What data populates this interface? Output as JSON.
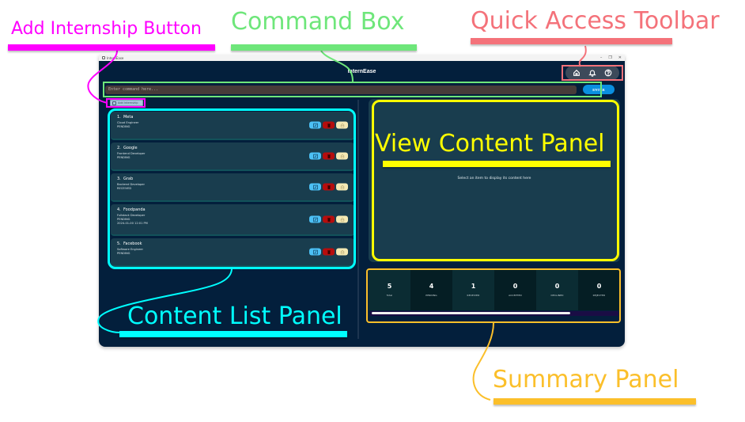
{
  "window": {
    "title": "InternEase",
    "controls": {
      "minimize": "–",
      "maximize": "❐",
      "close": "✕"
    }
  },
  "header": {
    "title": "InternEase"
  },
  "toolbar": {
    "buttons": [
      {
        "icon": "home-icon"
      },
      {
        "icon": "bell-icon"
      },
      {
        "icon": "help-icon"
      }
    ]
  },
  "command": {
    "placeholder": "Enter command here...",
    "value": "",
    "enter_label": "ENTER"
  },
  "add_button": {
    "label": "Add Internship"
  },
  "internships": [
    {
      "index": "1.",
      "company": "Meta",
      "role": "Cloud Engineer",
      "status": "PENDING",
      "extra": ""
    },
    {
      "index": "2.",
      "company": "Google",
      "role": "Frontend Developer",
      "status": "PENDING",
      "extra": ""
    },
    {
      "index": "3.",
      "company": "Grab",
      "role": "Backend Developer",
      "status": "RECEIVED",
      "extra": ""
    },
    {
      "index": "4.",
      "company": "Foodpanda",
      "role": "Fullstack Developer",
      "status": "PENDING",
      "extra": "2024-01-00 12:01 PM"
    },
    {
      "index": "5.",
      "company": "Facebook",
      "role": "Software Engineer",
      "status": "PENDING",
      "extra": ""
    }
  ],
  "view_panel": {
    "placeholder": "Select an item to display its content here"
  },
  "summary": {
    "stats": [
      {
        "value": "5",
        "label": "Total"
      },
      {
        "value": "4",
        "label": "PENDING"
      },
      {
        "value": "1",
        "label": "RECEIVED"
      },
      {
        "value": "0",
        "label": "ACCEPTED"
      },
      {
        "value": "0",
        "label": "DECLINED"
      },
      {
        "value": "0",
        "label": "REJECTED"
      }
    ],
    "scroll_fraction": 0.8
  },
  "annotations": {
    "add_internship": {
      "label": "Add Internship Button",
      "color": "#ff00ff"
    },
    "command_box": {
      "label": "Command Box",
      "color": "#6ee67a"
    },
    "quick_access": {
      "label": "Quick Access Toolbar",
      "color": "#f4727a"
    },
    "view_content": {
      "label": "View Content Panel",
      "color": "#ffff00"
    },
    "content_list": {
      "label": "Content List Panel",
      "color": "#00ffff"
    },
    "summary": {
      "label": "Summary Panel",
      "color": "#fbbf2a"
    }
  }
}
